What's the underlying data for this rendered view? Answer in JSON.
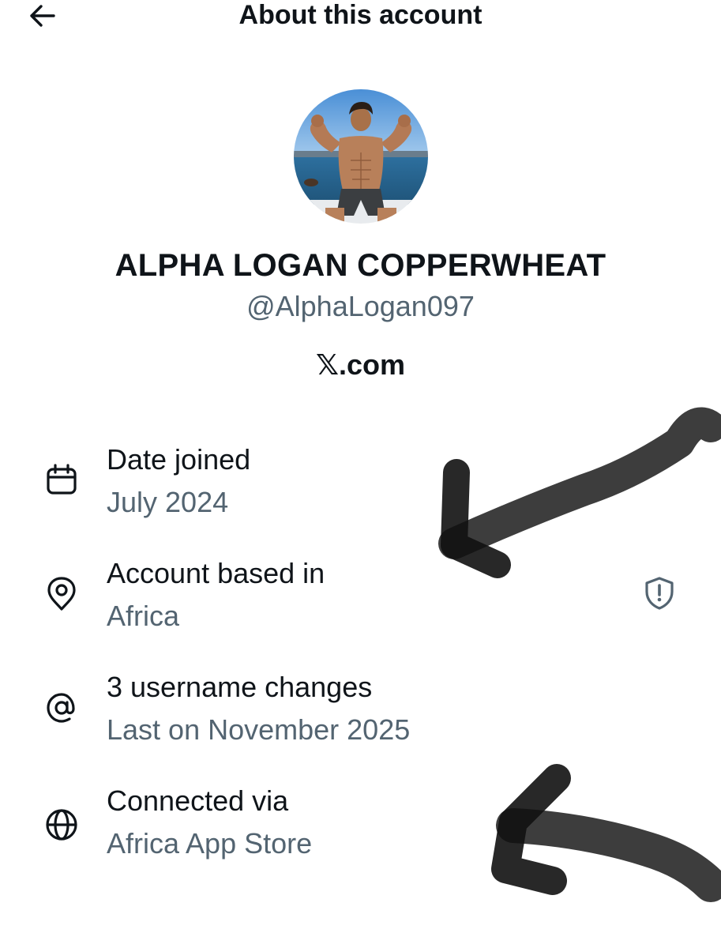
{
  "header": {
    "title": "About this account",
    "back_icon": "arrow-left-icon"
  },
  "profile": {
    "display_name": "ALPHA LOGAN COPPERWHEAT",
    "handle": "@AlphaLogan097",
    "platform": "𝕏.com"
  },
  "details": [
    {
      "icon": "calendar-icon",
      "label": "Date joined",
      "value": "July 2024"
    },
    {
      "icon": "location-pin-icon",
      "label": "Account based in",
      "value": "Africa"
    },
    {
      "icon": "at-sign-icon",
      "label": "3 username changes",
      "value": "Last on November 2025"
    },
    {
      "icon": "globe-icon",
      "label": "Connected via",
      "value": "Africa App Store"
    }
  ],
  "colors": {
    "primary_text": "#0f1419",
    "secondary_text": "#536471",
    "background": "#ffffff",
    "annotation": "#1a1a1a"
  }
}
